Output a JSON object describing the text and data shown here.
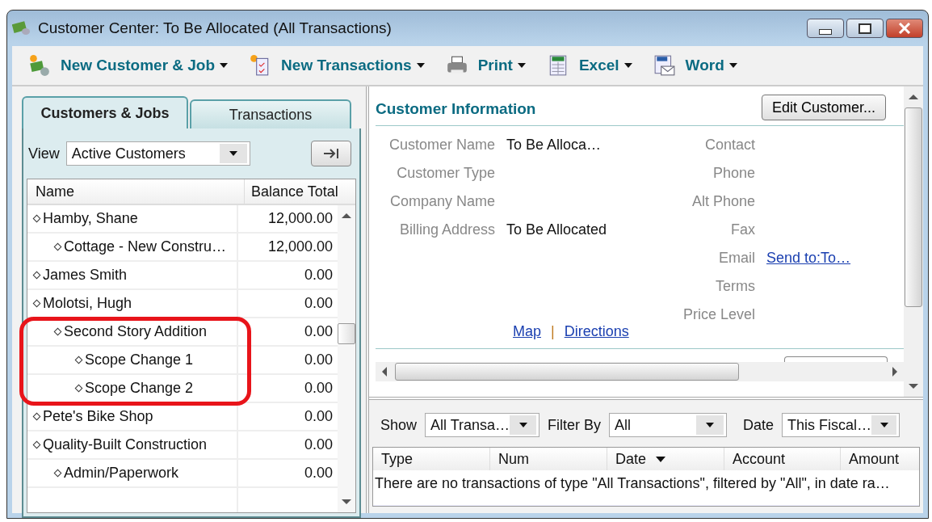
{
  "window": {
    "title": "Customer Center: To Be Allocated (All Transactions)"
  },
  "toolbar": [
    {
      "kind": "customer",
      "label": "New Customer & Job"
    },
    {
      "kind": "transaction",
      "label": "New Transactions"
    },
    {
      "kind": "print",
      "label": "Print"
    },
    {
      "kind": "excel",
      "label": "Excel"
    },
    {
      "kind": "word",
      "label": "Word"
    }
  ],
  "left_panel": {
    "tabs": [
      {
        "label": "Customers & Jobs",
        "selected": true
      },
      {
        "label": "Transactions",
        "selected": false
      }
    ],
    "view": {
      "label": "View",
      "value": "Active Customers"
    },
    "columns": [
      "Name",
      "Balance Total"
    ],
    "rows": [
      {
        "name": "Hamby, Shane",
        "balance": "12,000.00",
        "children": [
          {
            "name": "Cottage - New Constru…",
            "balance": "12,000.00"
          }
        ]
      },
      {
        "name": "James Smith",
        "balance": "0.00"
      },
      {
        "name": "Molotsi, Hugh",
        "balance": "0.00",
        "children": [
          {
            "name": "Second Story Addition",
            "balance": "0.00",
            "children": [
              {
                "name": "Scope Change 1",
                "balance": "0.00"
              },
              {
                "name": "Scope Change 2",
                "balance": "0.00"
              }
            ]
          }
        ]
      },
      {
        "name": "Pete's Bike Shop",
        "balance": "0.00"
      },
      {
        "name": "Quality-Built Construction",
        "balance": "0.00",
        "children": [
          {
            "name": "Admin/Paperwork",
            "balance": "0.00"
          }
        ]
      }
    ]
  },
  "customer_info": {
    "title": "Customer Information",
    "edit_button": "Edit Customer...",
    "fields_left": [
      {
        "label": "Customer Name",
        "value": "To Be Alloca…"
      },
      {
        "label": "Customer Type"
      },
      {
        "label": "Company Name"
      },
      {
        "label": "Billing Address",
        "value": "To Be Allocated"
      }
    ],
    "fields_right": [
      {
        "label": "Contact"
      },
      {
        "label": "Phone"
      },
      {
        "label": "Alt Phone"
      },
      {
        "label": "Fax"
      },
      {
        "label": "Email",
        "link": "Send to:To…"
      },
      {
        "label": "Terms"
      },
      {
        "label": "Price Level"
      }
    ],
    "map_links": [
      "Map",
      "Directions"
    ],
    "separator": "|"
  },
  "transactions": {
    "filters": [
      {
        "label": "Show",
        "value": "All Transa…"
      },
      {
        "label": "Filter By",
        "value": "All"
      },
      {
        "label": "Date",
        "value": "This Fiscal…"
      }
    ],
    "columns": [
      {
        "label": "Type",
        "sorted": false
      },
      {
        "label": "Num",
        "sorted": false
      },
      {
        "label": "Date",
        "sorted": true
      },
      {
        "label": "Account",
        "sorted": false
      },
      {
        "label": "Amount",
        "sorted": false
      }
    ],
    "message": "There are no transactions of type \"All Transactions\", filtered by \"All\", in date ra…"
  }
}
